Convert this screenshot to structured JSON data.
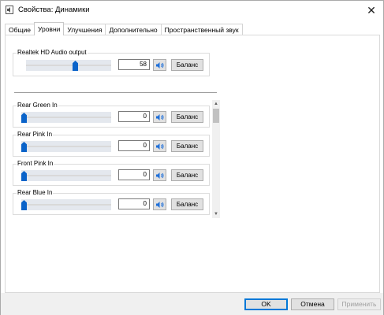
{
  "window": {
    "title": "Свойства: Динамики",
    "close_glyph": "✕"
  },
  "tabs": [
    {
      "label": "Общие",
      "active": false
    },
    {
      "label": "Уровни",
      "active": true
    },
    {
      "label": "Улучшения",
      "active": false
    },
    {
      "label": "Дополнительно",
      "active": false
    },
    {
      "label": "Пространственный звук",
      "active": false
    }
  ],
  "main_device": {
    "label": "Realtek HD Audio output",
    "value": "58",
    "level_percent": 58,
    "balance_label": "Баланс",
    "mute_icon": "speaker-icon"
  },
  "inputs": [
    {
      "label": "Rear Green In",
      "value": "0",
      "level_percent": 0,
      "balance_label": "Баланс"
    },
    {
      "label": "Rear Pink In",
      "value": "0",
      "level_percent": 0,
      "balance_label": "Баланс"
    },
    {
      "label": "Front Pink In",
      "value": "0",
      "level_percent": 0,
      "balance_label": "Баланс"
    },
    {
      "label": "Rear Blue In",
      "value": "0",
      "level_percent": 0,
      "balance_label": "Баланс"
    }
  ],
  "footer": {
    "ok_label": "OK",
    "cancel_label": "Отмена",
    "apply_label": "Применить"
  },
  "colors": {
    "slider_thumb": "#0a63c9",
    "slider_fill": "#e4e8ee",
    "default_button_border": "#0078d7"
  }
}
